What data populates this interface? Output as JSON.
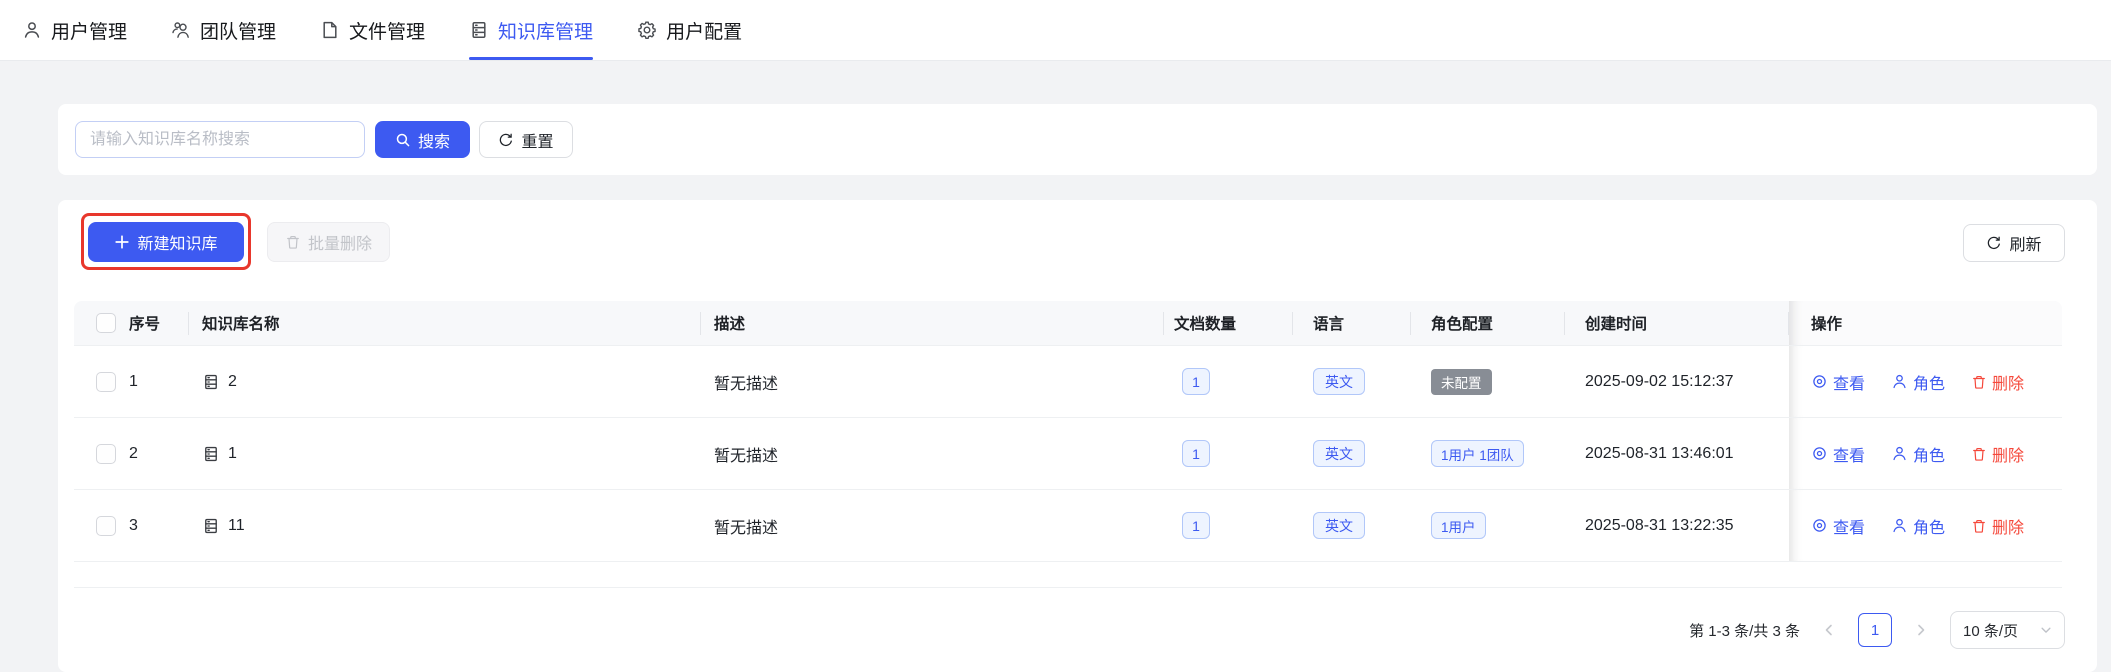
{
  "header": {
    "tabs": [
      {
        "label": "用户管理",
        "icon": "user-icon",
        "active": false
      },
      {
        "label": "团队管理",
        "icon": "team-icon",
        "active": false
      },
      {
        "label": "文件管理",
        "icon": "file-icon",
        "active": false
      },
      {
        "label": "知识库管理",
        "icon": "knowledge-base-icon",
        "active": true
      },
      {
        "label": "用户配置",
        "icon": "gear-icon",
        "active": false
      }
    ]
  },
  "search": {
    "placeholder": "请输入知识库名称搜索",
    "search_label": "搜索",
    "reset_label": "重置"
  },
  "toolbar": {
    "create_label": "新建知识库",
    "batch_delete_label": "批量删除",
    "refresh_label": "刷新"
  },
  "table": {
    "headers": {
      "index": "序号",
      "name": "知识库名称",
      "description": "描述",
      "doc_count": "文档数量",
      "language": "语言",
      "role_config": "角色配置",
      "created_at": "创建时间",
      "actions": "操作"
    },
    "rows": [
      {
        "index": "1",
        "name": "2",
        "description": "暂无描述",
        "doc_count": "1",
        "language": "英文",
        "role_config": "未配置",
        "role_type": "gray",
        "created_at": "2025-09-02 15:12:37"
      },
      {
        "index": "2",
        "name": "1",
        "description": "暂无描述",
        "doc_count": "1",
        "language": "英文",
        "role_config": "1用户 1团队",
        "role_type": "blue",
        "created_at": "2025-08-31 13:46:01"
      },
      {
        "index": "3",
        "name": "11",
        "description": "暂无描述",
        "doc_count": "1",
        "language": "英文",
        "role_config": "1用户",
        "role_type": "blue",
        "created_at": "2025-08-31 13:22:35"
      }
    ],
    "row_actions": {
      "view": "查看",
      "role": "角色",
      "delete": "删除"
    }
  },
  "pagination": {
    "total": "第 1-3 条/共 3 条",
    "current_page": "1",
    "page_size": "10 条/页"
  },
  "colors": {
    "primary": "#3d5af1",
    "danger": "#f5483b",
    "annotation_red": "#e8372c",
    "badge_blue_bg": "#eef4ff",
    "badge_blue_border": "#b1c7f9",
    "badge_gray_bg": "#888d95",
    "table_header_bg": "#f7f8fa",
    "page_bg": "#f2f3f5"
  }
}
